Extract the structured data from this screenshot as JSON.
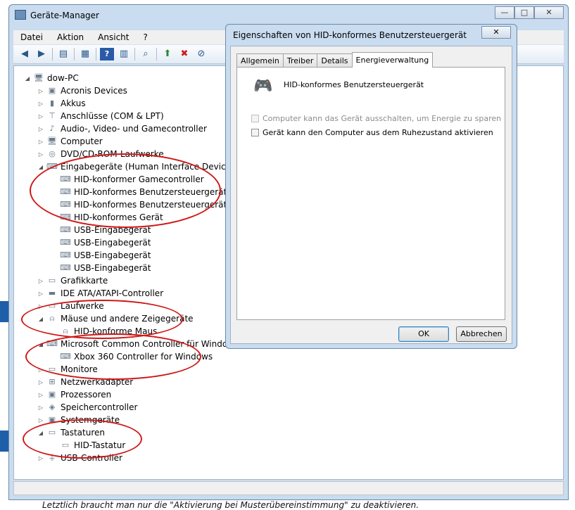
{
  "background": {
    "bottom_text": "Letztlich braucht man nur die \"Aktivierung bei Musterübereinstimmung\" zu deaktivieren."
  },
  "window": {
    "title": "Geräte-Manager",
    "controls": {
      "minimize": "—",
      "maximize": "□",
      "close": "✕"
    }
  },
  "menu": [
    "Datei",
    "Aktion",
    "Ansicht",
    "?"
  ],
  "toolbar": {
    "icons": [
      "back-arrow-icon",
      "forward-arrow-icon",
      "show-hide-console-tree-icon",
      "properties-icon",
      "help-icon",
      "action-pane-icon",
      "scan-hardware-icon",
      "update-driver-icon",
      "uninstall-icon",
      "disable-icon"
    ]
  },
  "tree": [
    {
      "label": "dow-PC",
      "level": 0,
      "expander": "◢",
      "icon": "computer-icon"
    },
    {
      "label": "Acronis Devices",
      "level": 1,
      "expander": "▷",
      "icon": "device-icon"
    },
    {
      "label": "Akkus",
      "level": 1,
      "expander": "▷",
      "icon": "battery-icon"
    },
    {
      "label": "Anschlüsse (COM & LPT)",
      "level": 1,
      "expander": "▷",
      "icon": "port-icon"
    },
    {
      "label": "Audio-, Video- und Gamecontroller",
      "level": 1,
      "expander": "▷",
      "icon": "audio-icon"
    },
    {
      "label": "Computer",
      "level": 1,
      "expander": "▷",
      "icon": "computer-icon"
    },
    {
      "label": "DVD/CD-ROM-Laufwerke",
      "level": 1,
      "expander": "▷",
      "icon": "disc-icon"
    },
    {
      "label": "Eingabegeräte (Human Interface Devices)",
      "level": 1,
      "expander": "◢",
      "icon": "hid-icon"
    },
    {
      "label": "HID-konformer Gamecontroller",
      "level": 2,
      "expander": "",
      "icon": "hid-icon"
    },
    {
      "label": "HID-konformes Benutzersteuergerät",
      "level": 2,
      "expander": "",
      "icon": "hid-icon"
    },
    {
      "label": "HID-konformes Benutzersteuergerät",
      "level": 2,
      "expander": "",
      "icon": "hid-icon"
    },
    {
      "label": "HID-konformes Gerät",
      "level": 2,
      "expander": "",
      "icon": "hid-icon"
    },
    {
      "label": "USB-Eingabegerät",
      "level": 2,
      "expander": "",
      "icon": "hid-icon"
    },
    {
      "label": "USB-Eingabegerät",
      "level": 2,
      "expander": "",
      "icon": "hid-icon"
    },
    {
      "label": "USB-Eingabegerät",
      "level": 2,
      "expander": "",
      "icon": "hid-icon"
    },
    {
      "label": "USB-Eingabegerät",
      "level": 2,
      "expander": "",
      "icon": "hid-icon"
    },
    {
      "label": "Grafikkarte",
      "level": 1,
      "expander": "▷",
      "icon": "display-adapter-icon"
    },
    {
      "label": "IDE ATA/ATAPI-Controller",
      "level": 1,
      "expander": "▷",
      "icon": "ide-icon"
    },
    {
      "label": "Laufwerke",
      "level": 1,
      "expander": "▷",
      "icon": "drive-icon"
    },
    {
      "label": "Mäuse und andere Zeigegeräte",
      "level": 1,
      "expander": "◢",
      "icon": "mouse-icon"
    },
    {
      "label": "HID-konforme Maus",
      "level": 2,
      "expander": "",
      "icon": "mouse-icon"
    },
    {
      "label": "Microsoft Common Controller für Windows-Klasse",
      "level": 1,
      "expander": "◢",
      "icon": "hid-icon"
    },
    {
      "label": "Xbox 360 Controller for Windows",
      "level": 2,
      "expander": "",
      "icon": "hid-icon"
    },
    {
      "label": "Monitore",
      "level": 1,
      "expander": "▷",
      "icon": "monitor-icon"
    },
    {
      "label": "Netzwerkadapter",
      "level": 1,
      "expander": "▷",
      "icon": "network-icon"
    },
    {
      "label": "Prozessoren",
      "level": 1,
      "expander": "▷",
      "icon": "cpu-icon"
    },
    {
      "label": "Speichercontroller",
      "level": 1,
      "expander": "▷",
      "icon": "storage-icon"
    },
    {
      "label": "Systemgeräte",
      "level": 1,
      "expander": "▷",
      "icon": "system-icon"
    },
    {
      "label": "Tastaturen",
      "level": 1,
      "expander": "◢",
      "icon": "keyboard-icon"
    },
    {
      "label": "HID-Tastatur",
      "level": 2,
      "expander": "",
      "icon": "keyboard-icon"
    },
    {
      "label": "USB-Controller",
      "level": 1,
      "expander": "▷",
      "icon": "usb-icon"
    }
  ],
  "dialog": {
    "title": "Eigenschaften von HID-konformes Benutzersteuergerät",
    "close": "✕",
    "tabs": [
      {
        "label": "Allgemein",
        "active": false
      },
      {
        "label": "Treiber",
        "active": false
      },
      {
        "label": "Details",
        "active": false
      },
      {
        "label": "Energieverwaltung",
        "active": true
      }
    ],
    "device_name": "HID-konformes Benutzersteuergerät",
    "checkboxes": [
      {
        "label": "Computer kann das Gerät ausschalten, um Energie zu sparen",
        "checked": false,
        "enabled": false
      },
      {
        "label": "Gerät kann den Computer aus dem Ruhezustand aktivieren",
        "checked": false,
        "enabled": true
      }
    ],
    "ok_label": "OK",
    "cancel_label": "Abbrechen"
  },
  "colors": {
    "annotation": "#d01818",
    "window_frame": "#c9dcf0"
  }
}
